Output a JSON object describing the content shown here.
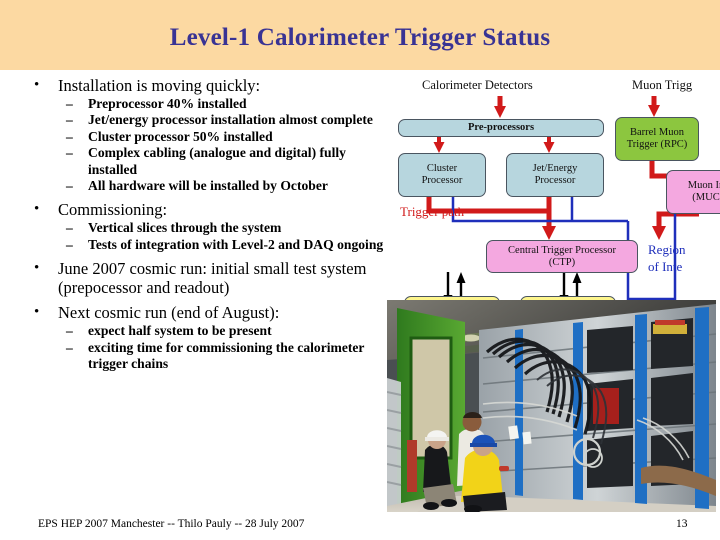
{
  "slide": {
    "title": "Level-1 Calorimeter Trigger Status",
    "title_color": "#393394",
    "header_bg": "#fcd9a2",
    "page_number": "13",
    "footer": "EPS HEP 2007 Manchester  --  Thilo Pauly  --  28 July 2007"
  },
  "bullets": [
    {
      "level": 1,
      "marker": "•",
      "text": "Installation is moving quickly:"
    },
    {
      "level": 2,
      "marker": "–",
      "text": "Preprocessor 40% installed"
    },
    {
      "level": 2,
      "marker": "–",
      "text": "Jet/energy processor installation almost complete"
    },
    {
      "level": 2,
      "marker": "–",
      "text": "Cluster processor 50% installed"
    },
    {
      "level": 2,
      "marker": "–",
      "text": "Complex cabling (analogue and digital) fully installed"
    },
    {
      "level": 2,
      "marker": "–",
      "text": "All hardware will be installed by October"
    },
    {
      "level": 1,
      "marker": "•",
      "text": "Commissioning:"
    },
    {
      "level": 2,
      "marker": "–",
      "text": "Vertical slices through the system"
    },
    {
      "level": 2,
      "marker": "–",
      "text": "Tests of integration with Level-2 and DAQ ongoing"
    },
    {
      "level": 1,
      "marker": "•",
      "text": "June 2007 cosmic run: initial small test system (prepocessor and readout)"
    },
    {
      "level": 1,
      "marker": "•",
      "text": "Next cosmic run (end of August):"
    },
    {
      "level": 2,
      "marker": "–",
      "text": "expect half system to be present"
    },
    {
      "level": 2,
      "marker": "–",
      "text": "exciting time for commissioning the calorimeter trigger chains"
    }
  ],
  "diagram": {
    "colors": {
      "calo_box": "#b7d6de",
      "muon_green": "#8cc63f",
      "pink": "#f4a8e0",
      "yellow": "#fdf58c",
      "trigger_path_red": "#d11a1a",
      "roi_blue": "#1f2fbb"
    },
    "labels": {
      "calorimeter_detectors": "Calorimeter Detectors",
      "muon_trigger_detectors": "Muon Trigg",
      "trigger_path": "Trigger path",
      "region_of_interest_line1": "Region",
      "region_of_interest_line2": "of Inte"
    },
    "boxes": {
      "preprocessors": "Pre-processors",
      "cluster_processor_l1": "Cluster",
      "cluster_processor_l2": "Processor",
      "jet_energy_processor_l1": "Jet/Energy",
      "jet_energy_processor_l2": "Processor",
      "barrel_muon_l1": "Barrel Muon",
      "barrel_muon_l2": "Trigger (RPC)",
      "muon_interface_l1": "Muon In",
      "muon_interface_l2": "(MUC",
      "ctp_l1": "Central Trigger Processor",
      "ctp_l2": "(CTP)"
    }
  }
}
